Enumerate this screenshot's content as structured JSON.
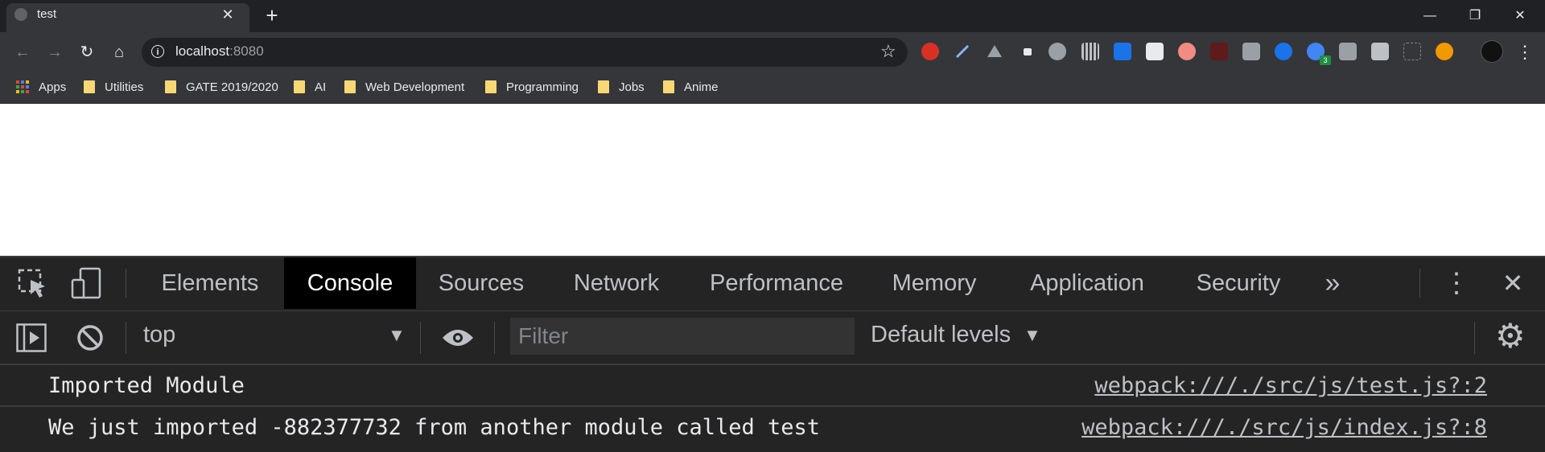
{
  "browser": {
    "tab_title": "test",
    "tab_close": "✕",
    "new_tab": "+",
    "window_controls": {
      "minimize": "—",
      "restore": "❐",
      "close": "✕"
    }
  },
  "toolbar": {
    "back": "←",
    "forward": "→",
    "reload": "↻",
    "home": "⌂",
    "info": "i",
    "url_host": "localhost",
    "url_port": ":8080",
    "star": "☆",
    "extension_badge": "3",
    "menu": "⋮"
  },
  "bookmarks": {
    "apps": "Apps",
    "items": [
      "Utilities",
      "GATE 2019/2020",
      "AI",
      "Web Development",
      "Programming",
      "Jobs",
      "Anime"
    ]
  },
  "devtools": {
    "tabs": [
      "Elements",
      "Console",
      "Sources",
      "Network",
      "Performance",
      "Memory",
      "Application",
      "Security"
    ],
    "more_tabs": "»",
    "more_menu": "⋮",
    "close": "✕",
    "context": "top",
    "context_arrow": "▼",
    "filter_placeholder": "Filter",
    "levels": "Default levels",
    "levels_arrow": "▼",
    "settings": "⚙"
  },
  "console": {
    "rows": [
      {
        "message": "Imported Module",
        "source": "webpack:///./src/js/test.js?:2"
      },
      {
        "message": "We just imported -882377732 from another module called test",
        "source": "webpack:///./src/js/index.js?:8"
      }
    ]
  },
  "colors": {
    "tab_strip": "#202124",
    "toolbar": "#35363a",
    "devtools_bg": "#242424",
    "console_tab_active": "#000000",
    "folder": "#f8d775"
  }
}
